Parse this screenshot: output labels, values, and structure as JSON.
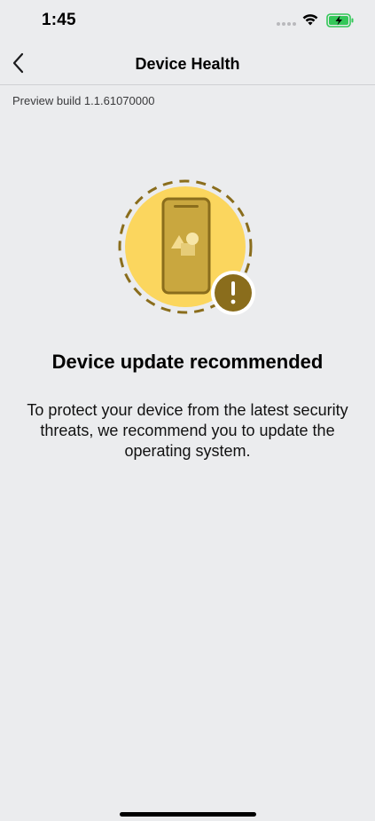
{
  "status_bar": {
    "time": "1:45"
  },
  "nav": {
    "title": "Device Health"
  },
  "build": {
    "label": "Preview build 1.1.61070000"
  },
  "content": {
    "headline": "Device update recommended",
    "description": "To protect your device from the latest security threats, we recommend you to update the operating system."
  },
  "icons": {
    "back": "chevron-left-icon",
    "wifi": "wifi-icon",
    "battery": "battery-charging-icon",
    "hero": "phone-warning-illustration",
    "warning": "exclamation-icon"
  },
  "colors": {
    "background": "#ebecee",
    "accent_yellow": "#fbd65e",
    "accent_dark": "#8a6d1c",
    "battery_green": "#34c759"
  }
}
